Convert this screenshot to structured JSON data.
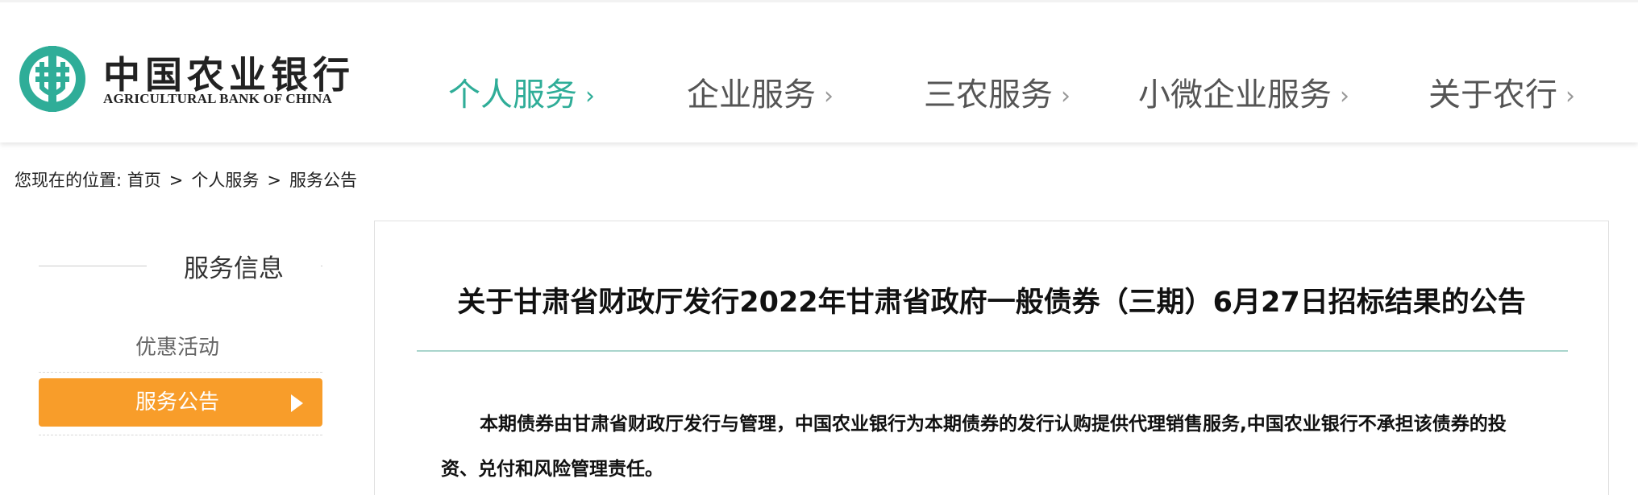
{
  "header": {
    "logo_cn": "中国农业银行",
    "logo_en": "AGRICULTURAL BANK OF CHINA",
    "brand_color": "#2fad98",
    "nav": [
      {
        "label": "个人服务",
        "active": true
      },
      {
        "label": "企业服务",
        "active": false
      },
      {
        "label": "三农服务",
        "active": false
      },
      {
        "label": "小微企业服务",
        "active": false
      },
      {
        "label": "关于农行",
        "active": false
      }
    ],
    "chevron": "›"
  },
  "breadcrumb": {
    "prefix": "您现在的位置:",
    "items": [
      "首页",
      "个人服务",
      "服务公告"
    ],
    "separator": ">"
  },
  "sidebar": {
    "title": "服务信息",
    "items": [
      {
        "label": "优惠活动",
        "active": false
      },
      {
        "label": "服务公告",
        "active": true
      }
    ],
    "active_color": "#f89d2a"
  },
  "article": {
    "title": "关于甘肃省财政厅发行2022年甘肃省政府一般债券（三期）6月27日招标结果的公告",
    "paragraph": "本期债券由甘肃省财政厅发行与管理，中国农业银行为本期债券的发行认购提供代理销售服务,中国农业银行不承担该债券的投资、兑付和风险管理责任。"
  }
}
